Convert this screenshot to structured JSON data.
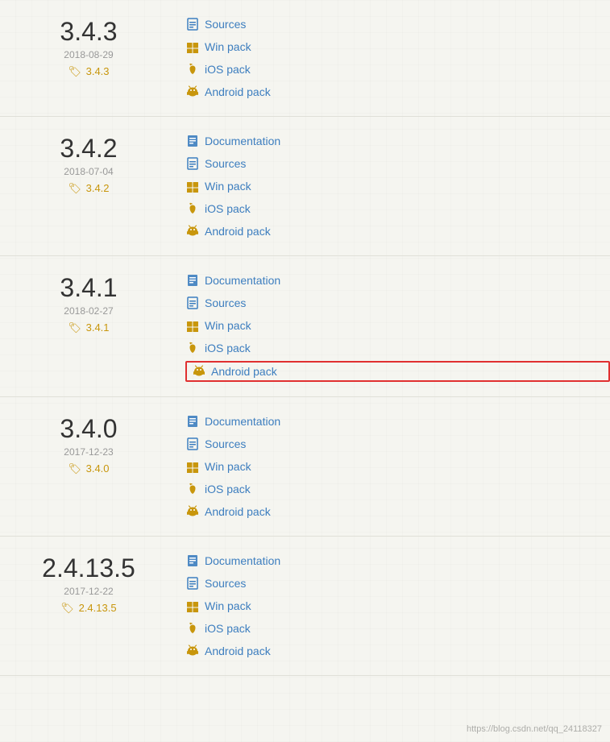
{
  "versions": [
    {
      "id": "v343",
      "number": "3.4.3",
      "date": "2018-08-29",
      "tag": "3.4.3",
      "links": [
        {
          "type": "sources",
          "label": "Sources",
          "iconClass": "src",
          "icon": "📄",
          "highlighted": false
        },
        {
          "type": "win",
          "label": "Win pack",
          "iconClass": "win",
          "icon": "🪟",
          "highlighted": false
        },
        {
          "type": "ios",
          "label": "iOS pack",
          "iconClass": "ios",
          "icon": "🍎",
          "highlighted": false
        },
        {
          "type": "android",
          "label": "Android pack",
          "iconClass": "android",
          "icon": "🤖",
          "highlighted": false
        }
      ]
    },
    {
      "id": "v342",
      "number": "3.4.2",
      "date": "2018-07-04",
      "tag": "3.4.2",
      "links": [
        {
          "type": "doc",
          "label": "Documentation",
          "iconClass": "doc",
          "icon": "📘",
          "highlighted": false
        },
        {
          "type": "sources",
          "label": "Sources",
          "iconClass": "src",
          "icon": "📄",
          "highlighted": false
        },
        {
          "type": "win",
          "label": "Win pack",
          "iconClass": "win",
          "icon": "🪟",
          "highlighted": false
        },
        {
          "type": "ios",
          "label": "iOS pack",
          "iconClass": "ios",
          "icon": "🍎",
          "highlighted": false
        },
        {
          "type": "android",
          "label": "Android pack",
          "iconClass": "android",
          "icon": "🤖",
          "highlighted": false
        }
      ]
    },
    {
      "id": "v341",
      "number": "3.4.1",
      "date": "2018-02-27",
      "tag": "3.4.1",
      "links": [
        {
          "type": "doc",
          "label": "Documentation",
          "iconClass": "doc",
          "icon": "📘",
          "highlighted": false
        },
        {
          "type": "sources",
          "label": "Sources",
          "iconClass": "src",
          "icon": "📄",
          "highlighted": false
        },
        {
          "type": "win",
          "label": "Win pack",
          "iconClass": "win",
          "icon": "🪟",
          "highlighted": false
        },
        {
          "type": "ios",
          "label": "iOS pack",
          "iconClass": "ios",
          "icon": "🍎",
          "highlighted": false
        },
        {
          "type": "android",
          "label": "Android pack",
          "iconClass": "android",
          "icon": "🤖",
          "highlighted": true
        }
      ]
    },
    {
      "id": "v340",
      "number": "3.4.0",
      "date": "2017-12-23",
      "tag": "3.4.0",
      "links": [
        {
          "type": "doc",
          "label": "Documentation",
          "iconClass": "doc",
          "icon": "📘",
          "highlighted": false
        },
        {
          "type": "sources",
          "label": "Sources",
          "iconClass": "src",
          "icon": "📄",
          "highlighted": false
        },
        {
          "type": "win",
          "label": "Win pack",
          "iconClass": "win",
          "icon": "🪟",
          "highlighted": false
        },
        {
          "type": "ios",
          "label": "iOS pack",
          "iconClass": "ios",
          "icon": "🍎",
          "highlighted": false
        },
        {
          "type": "android",
          "label": "Android pack",
          "iconClass": "android",
          "icon": "🤖",
          "highlighted": false
        }
      ]
    },
    {
      "id": "v24135",
      "number": "2.4.13.5",
      "date": "2017-12-22",
      "tag": "2.4.13.5",
      "links": [
        {
          "type": "doc",
          "label": "Documentation",
          "iconClass": "doc",
          "icon": "📘",
          "highlighted": false
        },
        {
          "type": "sources",
          "label": "Sources",
          "iconClass": "src",
          "icon": "📄",
          "highlighted": false
        },
        {
          "type": "win",
          "label": "Win pack",
          "iconClass": "win",
          "icon": "🪟",
          "highlighted": false
        },
        {
          "type": "ios",
          "label": "iOS pack",
          "iconClass": "ios",
          "icon": "🍎",
          "highlighted": false
        },
        {
          "type": "android",
          "label": "Android pack",
          "iconClass": "android",
          "icon": "🤖",
          "highlighted": false
        }
      ]
    }
  ],
  "watermark": "https://blog.csdn.net/qq_24118327"
}
